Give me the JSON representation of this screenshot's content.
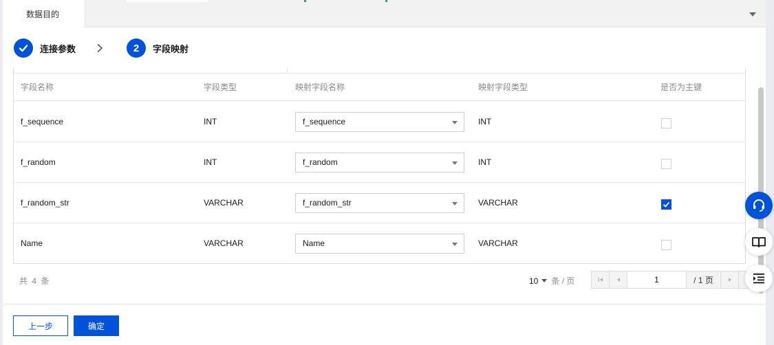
{
  "tab": {
    "label": "数据目的"
  },
  "steps": [
    {
      "label": "连接参数",
      "done": true
    },
    {
      "number": "2",
      "label": "字段映射",
      "done": false
    }
  ],
  "table": {
    "headers": [
      "字段名称",
      "字段类型",
      "映射字段名称",
      "映射字段类型",
      "是否为主键"
    ],
    "rows": [
      {
        "field": "f_sequence",
        "type": "INT",
        "mapped_field": "f_sequence",
        "mapped_type": "INT",
        "primary_key": false
      },
      {
        "field": "f_random",
        "type": "INT",
        "mapped_field": "f_random",
        "mapped_type": "INT",
        "primary_key": false
      },
      {
        "field": "f_random_str",
        "type": "VARCHAR",
        "mapped_field": "f_random_str",
        "mapped_type": "VARCHAR",
        "primary_key": true
      },
      {
        "field": "Name",
        "type": "VARCHAR",
        "mapped_field": "Name",
        "mapped_type": "VARCHAR",
        "primary_key": false
      }
    ]
  },
  "pagination": {
    "total": "共 4 条",
    "page_size": "10",
    "page_size_unit": "条 / 页",
    "current_page": "1",
    "page_total": "/ 1 页"
  },
  "buttons": {
    "prev": "上一步",
    "confirm": "确定"
  },
  "colors": {
    "primary": "#0052d9",
    "green_accent": "#2ba471"
  },
  "float_icons": [
    "headset-icon",
    "book-icon",
    "menu-indent-icon"
  ]
}
